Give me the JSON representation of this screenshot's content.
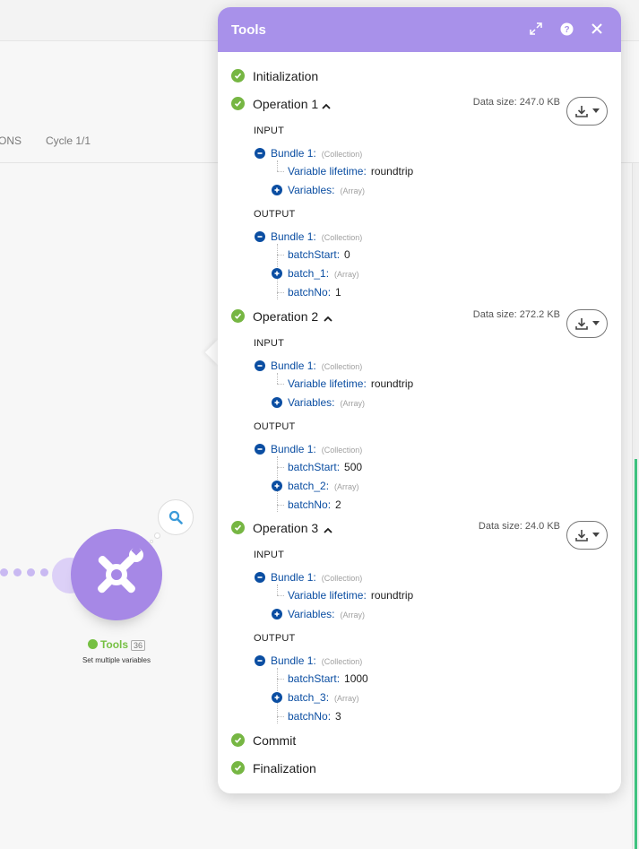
{
  "background": {
    "tabs": [
      "ONS",
      "Cycle 1/1"
    ],
    "module": {
      "name": "Tools",
      "count": "36",
      "subtitle": "Set multiple variables",
      "icon": "tools-icon"
    }
  },
  "panel": {
    "title": "Tools",
    "header_icons": [
      "expand-icon",
      "help-icon",
      "close-icon"
    ],
    "sections": [
      {
        "label": "Initialization"
      },
      {
        "label": "Operation 1",
        "data_size": "Data size: 247.0 KB",
        "input_label": "INPUT",
        "input": {
          "bundle": "Bundle 1:",
          "bundle_type": "(Collection)",
          "var_lifetime_key": "Variable lifetime:",
          "var_lifetime_val": "roundtrip",
          "variables_key": "Variables:",
          "variables_type": "(Array)"
        },
        "output_label": "OUTPUT",
        "output": {
          "bundle": "Bundle 1:",
          "bundle_type": "(Collection)",
          "batch_start_key": "batchStart:",
          "batch_start_val": "0",
          "batch_key": "batch_1:",
          "batch_type": "(Array)",
          "batch_no_key": "batchNo:",
          "batch_no_val": "1"
        }
      },
      {
        "label": "Operation 2",
        "data_size": "Data size: 272.2 KB",
        "input_label": "INPUT",
        "input": {
          "bundle": "Bundle 1:",
          "bundle_type": "(Collection)",
          "var_lifetime_key": "Variable lifetime:",
          "var_lifetime_val": "roundtrip",
          "variables_key": "Variables:",
          "variables_type": "(Array)"
        },
        "output_label": "OUTPUT",
        "output": {
          "bundle": "Bundle 1:",
          "bundle_type": "(Collection)",
          "batch_start_key": "batchStart:",
          "batch_start_val": "500",
          "batch_key": "batch_2:",
          "batch_type": "(Array)",
          "batch_no_key": "batchNo:",
          "batch_no_val": "2"
        }
      },
      {
        "label": "Operation 3",
        "data_size": "Data size: 24.0 KB",
        "input_label": "INPUT",
        "input": {
          "bundle": "Bundle 1:",
          "bundle_type": "(Collection)",
          "var_lifetime_key": "Variable lifetime:",
          "var_lifetime_val": "roundtrip",
          "variables_key": "Variables:",
          "variables_type": "(Array)"
        },
        "output_label": "OUTPUT",
        "output": {
          "bundle": "Bundle 1:",
          "bundle_type": "(Collection)",
          "batch_start_key": "batchStart:",
          "batch_start_val": "1000",
          "batch_key": "batch_3:",
          "batch_type": "(Array)",
          "batch_no_key": "batchNo:",
          "batch_no_val": "3"
        }
      },
      {
        "label": "Commit"
      },
      {
        "label": "Finalization"
      }
    ]
  },
  "colors": {
    "header": "#a891ea",
    "success": "#76b643",
    "link": "#0b4ea2",
    "module": "#a688e6"
  }
}
